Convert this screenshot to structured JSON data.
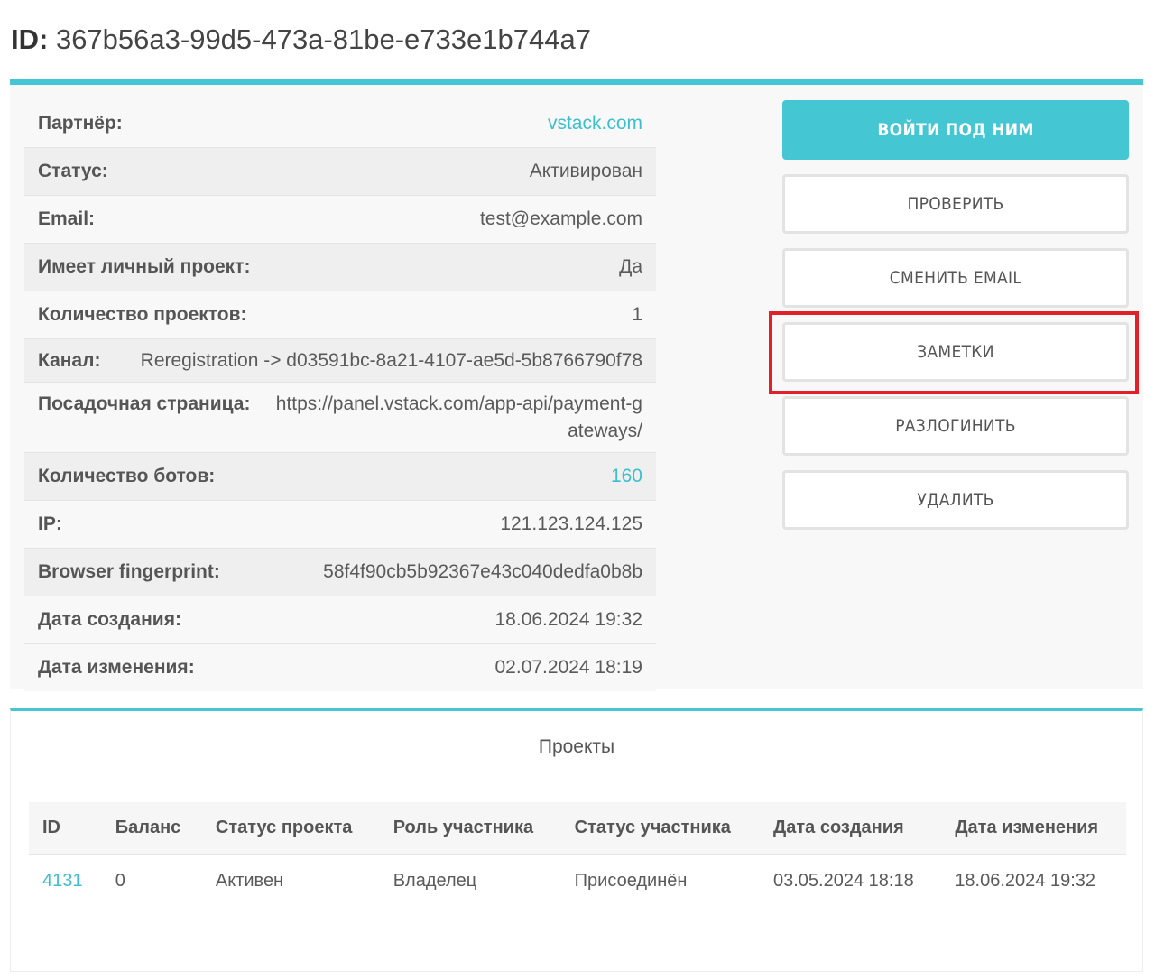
{
  "header": {
    "id_label": "ID:",
    "id_value": "367b56a3-99d5-473a-81be-e733e1b744a7"
  },
  "user_info": [
    {
      "label": "Партнёр:",
      "value": "vstack.com",
      "link": true
    },
    {
      "label": "Статус:",
      "value": "Активирован",
      "link": false
    },
    {
      "label": "Email:",
      "value": "test@example.com",
      "link": false
    },
    {
      "label": "Имеет личный проект:",
      "value": "Да",
      "link": false
    },
    {
      "label": "Количество проектов:",
      "value": "1",
      "link": false
    },
    {
      "label": "Канал:",
      "value": "Reregistration -> d03591bc-8a21-4107-ae5d-5b8766790f78",
      "link": false
    },
    {
      "label": "Посадочная страница:",
      "value": "https://panel.vstack.com/app-api/payment-gateways/",
      "link": false
    },
    {
      "label": "Количество ботов:",
      "value": "160",
      "link": true
    },
    {
      "label": "IP:",
      "value": "121.123.124.125",
      "link": false
    },
    {
      "label": "Browser fingerprint:",
      "value": "58f4f90cb5b92367e43c040dedfa0b8b",
      "link": false
    },
    {
      "label": "Дата создания:",
      "value": "18.06.2024 19:32",
      "link": false
    },
    {
      "label": "Дата изменения:",
      "value": "02.07.2024 18:19",
      "link": false
    }
  ],
  "actions": {
    "login_as": "ВОЙТИ ПОД НИМ",
    "check": "ПРОВЕРИТЬ",
    "change_email": "СМЕНИТЬ EMAIL",
    "notes": "ЗАМЕТКИ",
    "logout": "РАЗЛОГИНИТЬ",
    "delete": "УДАЛИТЬ"
  },
  "projects": {
    "title": "Проекты",
    "columns": [
      "ID",
      "Баланс",
      "Статус проекта",
      "Роль участника",
      "Статус участника",
      "Дата создания",
      "Дата изменения"
    ],
    "rows": [
      [
        "4131",
        "0",
        "Активен",
        "Владелец",
        "Присоединён",
        "03.05.2024 18:18",
        "18.06.2024 19:32"
      ]
    ]
  },
  "colors": {
    "accent": "#45c6d3",
    "link": "#3bbfcd",
    "highlight": "#e2202a"
  }
}
